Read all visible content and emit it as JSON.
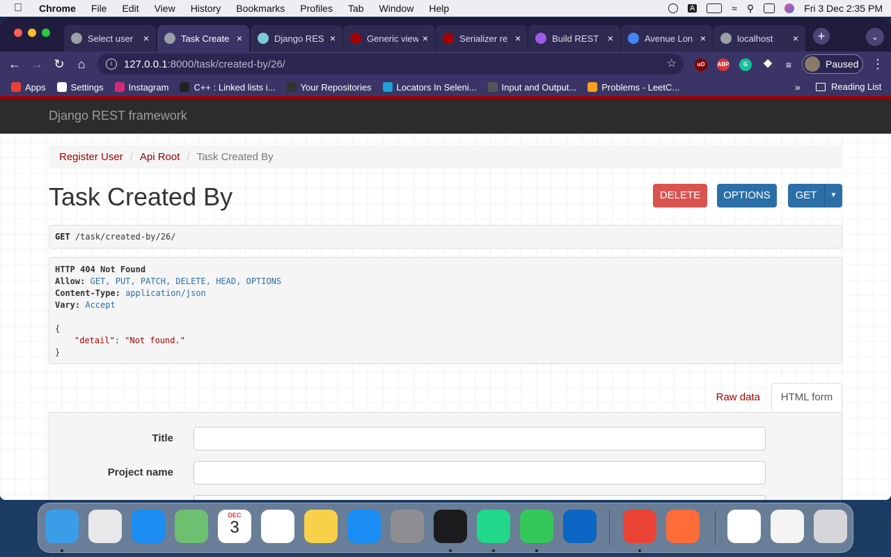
{
  "menubar": {
    "app": "Chrome",
    "items": [
      "File",
      "Edit",
      "View",
      "History",
      "Bookmarks",
      "Profiles",
      "Tab",
      "Window",
      "Help"
    ],
    "datetime": "Fri 3 Dec  2:35 PM"
  },
  "tabs": [
    {
      "label": "Select user",
      "color": "#9aa0a6"
    },
    {
      "label": "Task Create",
      "color": "#9aa0a6"
    },
    {
      "label": "Django RES",
      "color": "#7ec8d8"
    },
    {
      "label": "Generic view",
      "color": "#a30000"
    },
    {
      "label": "Serializer re",
      "color": "#a30000"
    },
    {
      "label": "Build REST",
      "color": "#9b5de5"
    },
    {
      "label": "Avenue Lon",
      "color": "#4285f4"
    },
    {
      "label": "localhost",
      "color": "#9aa0a6"
    }
  ],
  "toolbar": {
    "url_host": "127.0.0.1",
    "url_rest": ":8000/task/created-by/26/",
    "profile_label": "Paused"
  },
  "bookmarks": [
    {
      "label": "Apps",
      "color": "#e94235"
    },
    {
      "label": "Settings",
      "color": "#ffffff"
    },
    {
      "label": "Instagram",
      "color": "#d62976"
    },
    {
      "label": "C++ : Linked lists i...",
      "color": "#222222"
    },
    {
      "label": "Your Repositories",
      "color": "#333333"
    },
    {
      "label": "Locators In Seleni...",
      "color": "#1fa2d6"
    },
    {
      "label": "Input and Output...",
      "color": "#555555"
    },
    {
      "label": "Problems - LeetC...",
      "color": "#f89f1b"
    }
  ],
  "reading_list": "Reading List",
  "page": {
    "brand": "Django REST framework",
    "breadcrumbs": [
      "Register User",
      "Api Root"
    ],
    "breadcrumb_current": "Task Created By",
    "title": "Task Created By",
    "buttons": {
      "delete": "DELETE",
      "options": "OPTIONS",
      "get": "GET"
    },
    "request_method": "GET",
    "request_path": "/task/created-by/26/",
    "response": {
      "status": "HTTP 404 Not Found",
      "allow_key": "Allow:",
      "allow_val": "GET, PUT, PATCH, DELETE, HEAD, OPTIONS",
      "ctype_key": "Content-Type:",
      "ctype_val": "application/json",
      "vary_key": "Vary:",
      "vary_val": "Accept",
      "open": "{",
      "detail_key": "\"detail\"",
      "colon": ": ",
      "detail_val": "\"Not found.\"",
      "close": "}"
    },
    "tab_raw": "Raw data",
    "tab_html": "HTML form",
    "fields": [
      {
        "label": "Title"
      },
      {
        "label": "Project name"
      }
    ]
  },
  "dock": {
    "apps": [
      {
        "name": "finder",
        "color": "#3a9de8"
      },
      {
        "name": "launchpad",
        "color": "#e8e8ea"
      },
      {
        "name": "safari",
        "color": "#1b8cf0"
      },
      {
        "name": "maps",
        "color": "#6cc070"
      },
      {
        "name": "calendar",
        "color": "#ffffff"
      },
      {
        "name": "reminders",
        "color": "#ffffff"
      },
      {
        "name": "notes",
        "color": "#f7d14a"
      },
      {
        "name": "app-store",
        "color": "#1a8df5"
      },
      {
        "name": "system-preferences",
        "color": "#8e8e93"
      },
      {
        "name": "terminal",
        "color": "#1c1c1e"
      },
      {
        "name": "pycharm",
        "color": "#21d789"
      },
      {
        "name": "messages",
        "color": "#34c759"
      },
      {
        "name": "vscode",
        "color": "#0a66c2"
      },
      {
        "name": "chrome",
        "color": "#ea4335"
      },
      {
        "name": "postman",
        "color": "#ff6c37"
      },
      {
        "name": "doc-1",
        "color": "#ffffff"
      },
      {
        "name": "doc-2",
        "color": "#f4f4f4"
      },
      {
        "name": "trash",
        "color": "#d6d6da"
      }
    ],
    "calendar_month": "DEC",
    "calendar_day": "3"
  }
}
